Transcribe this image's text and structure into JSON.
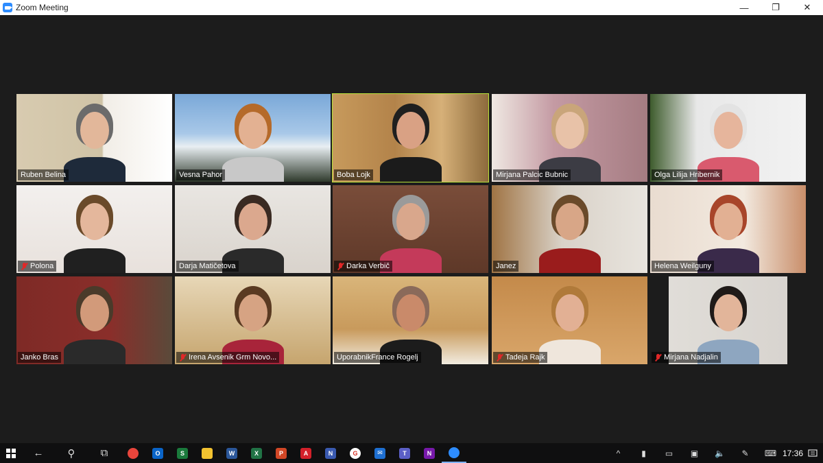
{
  "window": {
    "title": "Zoom Meeting",
    "minimize": "—",
    "restore": "❐",
    "close": "✕"
  },
  "participants": [
    {
      "name": "Ruben Belina",
      "muted": false,
      "active": false
    },
    {
      "name": "Vesna Pahor",
      "muted": false,
      "active": false
    },
    {
      "name": "Boba Lojk",
      "muted": false,
      "active": true
    },
    {
      "name": "Mirjana Palcic Bubnic",
      "muted": false,
      "active": false
    },
    {
      "name": "Olga Lilija Hribernik",
      "muted": false,
      "active": false
    },
    {
      "name": "Polona",
      "muted": true,
      "active": false
    },
    {
      "name": "Darja Matičetova",
      "muted": false,
      "active": false
    },
    {
      "name": "Darka Verbič",
      "muted": true,
      "active": false
    },
    {
      "name": "Janez",
      "muted": false,
      "active": false
    },
    {
      "name": "Helena Weilguny",
      "muted": false,
      "active": false
    },
    {
      "name": "Janko Bras",
      "muted": false,
      "active": false
    },
    {
      "name": "Irena Avsenik Grm Novo...",
      "muted": true,
      "active": false
    },
    {
      "name": "UporabnikFrance Rogelj",
      "muted": false,
      "active": false
    },
    {
      "name": "Tadeja Rajk",
      "muted": true,
      "active": false
    },
    {
      "name": "Mirjana Nadjalin",
      "muted": true,
      "active": false
    }
  ],
  "colors": {
    "active_speaker_border": "#b9e33a",
    "mute_red": "#e02828",
    "zoom_blue": "#2d8cff"
  },
  "taskbar": {
    "apps": [
      {
        "icon": "back-arrow-icon",
        "glyph": "←"
      },
      {
        "icon": "search-icon",
        "glyph": "⚲"
      },
      {
        "icon": "task-view-icon",
        "glyph": "⧉"
      },
      {
        "icon": "chrome-icon",
        "glyph": "",
        "color": "#e8453c"
      },
      {
        "icon": "outlook-icon",
        "glyph": "O",
        "color": "#0a64c8"
      },
      {
        "icon": "skype-icon",
        "glyph": "S",
        "color": "#1a7a3c"
      },
      {
        "icon": "file-explorer-icon",
        "glyph": "",
        "color": "#f2c230"
      },
      {
        "icon": "word-icon",
        "glyph": "W",
        "color": "#2b579a"
      },
      {
        "icon": "excel-icon",
        "glyph": "X",
        "color": "#217346"
      },
      {
        "icon": "powerpoint-icon",
        "glyph": "P",
        "color": "#d24726"
      },
      {
        "icon": "acrobat-icon",
        "glyph": "A",
        "color": "#d3202a"
      },
      {
        "icon": "nfs-icon",
        "glyph": "N",
        "color": "#3a5ab0"
      },
      {
        "icon": "gmail-icon",
        "glyph": "G",
        "color": "#ffffff"
      },
      {
        "icon": "mail-icon",
        "glyph": "✉",
        "color": "#1e6fd1"
      },
      {
        "icon": "teams-icon",
        "glyph": "T",
        "color": "#5b5fc7"
      },
      {
        "icon": "onenote-icon",
        "glyph": "N",
        "color": "#7719aa"
      },
      {
        "icon": "zoom-icon",
        "glyph": "",
        "color": "#2d8cff",
        "running": true
      }
    ],
    "tray": [
      {
        "icon": "chevron-up-icon",
        "glyph": "^"
      },
      {
        "icon": "usb-icon",
        "glyph": "▮"
      },
      {
        "icon": "battery-icon",
        "glyph": "▭"
      },
      {
        "icon": "network-icon",
        "glyph": "▣"
      },
      {
        "icon": "volume-icon",
        "glyph": "🔈"
      },
      {
        "icon": "pen-icon",
        "glyph": "✎"
      },
      {
        "icon": "keyboard-icon",
        "glyph": "⌨"
      }
    ],
    "clock": "17:36",
    "notifications_icon": "notification-icon"
  }
}
